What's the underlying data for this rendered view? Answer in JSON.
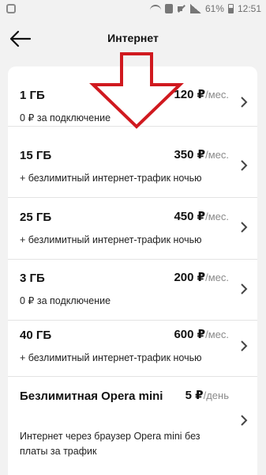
{
  "statusbar": {
    "battery": "61%",
    "time": "12:51"
  },
  "header": {
    "title": "Интернет"
  },
  "tariffs": [
    {
      "name": "1 ГБ",
      "price": "120 ₽",
      "unit": "/мес.",
      "desc": "0 ₽ за подключение"
    },
    {
      "name": "15 ГБ",
      "price": "350 ₽",
      "unit": "/мес.",
      "desc": "+ безлимитный интернет-трафик ночью"
    },
    {
      "name": "25 ГБ",
      "price": "450 ₽",
      "unit": "/мес.",
      "desc": "+ безлимитный интернет-трафик ночью"
    },
    {
      "name": "3 ГБ",
      "price": "200 ₽",
      "unit": "/мес.",
      "desc": "0 ₽ за подключение"
    },
    {
      "name": "40 ГБ",
      "price": "600 ₽",
      "unit": "/мес.",
      "desc": "+ безлимитный интернет-трафик ночью"
    },
    {
      "name": "Безлимитная Opera mini",
      "price": "5 ₽",
      "unit": "/день",
      "desc": "Интернет через браузер Opera mini без платы за трафик"
    }
  ],
  "colors": {
    "annotation_arrow": "#d0191f",
    "chevron": "#444444"
  }
}
